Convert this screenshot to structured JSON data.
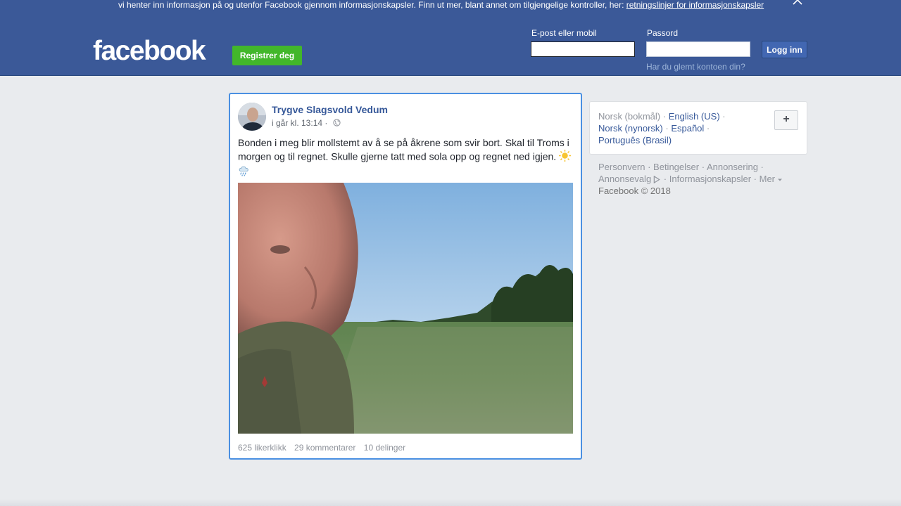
{
  "cookie_banner": {
    "text": "vi henter inn informasjon på og utenfor Facebook gjennom informasjonskapsler. Finn ut mer, blant annet om tilgjengelige kontroller, her:",
    "link": "retningslinjer for informasjonskapsler",
    "close_icon": "close-icon"
  },
  "header": {
    "logo": "facebook",
    "register_label": "Registrer deg",
    "email_label": "E-post eller mobil",
    "email_value": "",
    "password_label": "Passord",
    "password_value": "",
    "login_label": "Logg inn",
    "forgot_link": "Har du glemt kontoen din?"
  },
  "post": {
    "author": "Trygve Slagsvold Vedum",
    "timestamp": "i går kl. 13:14",
    "meta_separator": "·",
    "privacy_icon": "globe-icon",
    "text": "Bonden i meg blir mollstemt av å se på åkrene som svir bort. Skal til Troms i morgen og til regnet. Skulle gjerne tatt med sola opp og regnet ned igjen.",
    "emojis": [
      "sun-emoji",
      "rain-cloud-emoji"
    ],
    "stats": {
      "likes": "625 likerklikk",
      "comments": "29 kommentarer",
      "shares": "10 delinger"
    }
  },
  "sidebar": {
    "languages": {
      "current": "Norsk (bokmål)",
      "options": [
        "English (US)",
        "Norsk (nynorsk)",
        "Español",
        "Português (Brasil)"
      ],
      "add_label": "+"
    },
    "footer": {
      "links": [
        "Personvern",
        "Betingelser",
        "Annonsering",
        "Annonsevalg",
        "Informasjonskapsler",
        "Mer"
      ],
      "copyright": "Facebook © 2018"
    }
  },
  "colors": {
    "brand_blue": "#3b5998",
    "button_green": "#42b72a",
    "link_blue": "#365899",
    "focus_border": "#4a90e2"
  }
}
